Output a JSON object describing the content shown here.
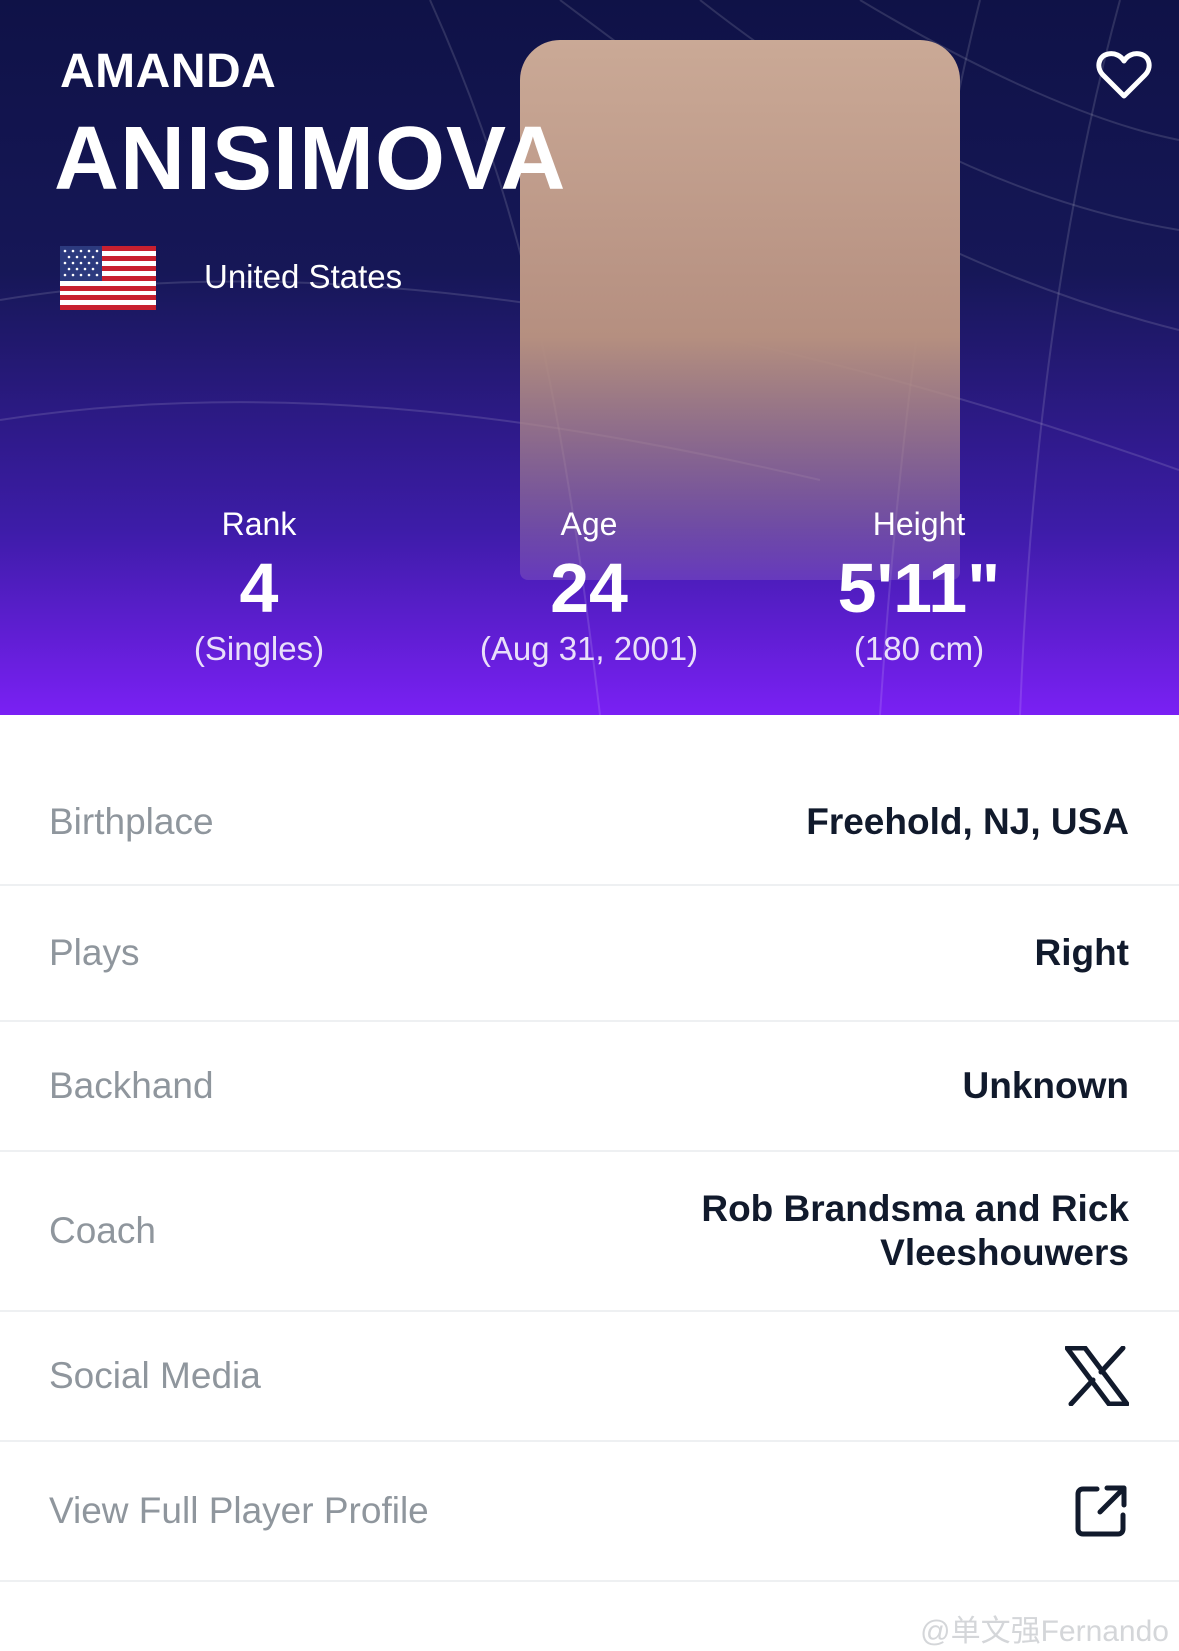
{
  "player": {
    "first_name": "AMANDA",
    "last_name": "ANISIMOVA",
    "country": "United States",
    "flag_icon": "us-flag-icon"
  },
  "stats": [
    {
      "label": "Rank",
      "value": "4",
      "sub": "(Singles)"
    },
    {
      "label": "Age",
      "value": "24",
      "sub": "(Aug 31, 2001)"
    },
    {
      "label": "Height",
      "value": "5'11\"",
      "sub": "(180 cm)"
    }
  ],
  "details": {
    "birthplace": {
      "label": "Birthplace",
      "value": "Freehold, NJ, USA"
    },
    "plays": {
      "label": "Plays",
      "value": "Right"
    },
    "backhand": {
      "label": "Backhand",
      "value": "Unknown"
    },
    "coach": {
      "label": "Coach",
      "value_line1": "Rob Brandsma and Rick",
      "value_line2": "Vleeshouwers"
    },
    "social": {
      "label": "Social Media",
      "icon": "x-logo-icon"
    },
    "profile": {
      "label": "View Full Player Profile",
      "icon": "external-link-icon"
    }
  },
  "watermark": "@单文强Fernando",
  "colors": {
    "hero_top": "#0f1247",
    "hero_bottom": "#7a20f4",
    "label_gray": "#8f969d",
    "value_dark": "#111a2c"
  }
}
